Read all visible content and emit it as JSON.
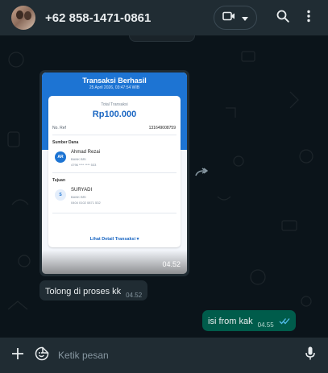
{
  "header": {
    "contact_name": "+62 858-1471-0861",
    "video_icon": "video-camera-icon",
    "dropdown_icon": "chevron-down-icon",
    "search_icon": "search-icon",
    "menu_icon": "kebab-menu-icon"
  },
  "receipt": {
    "title": "Transaksi Berhasil",
    "datetime": "25 April 2026, 03:47:54 WIB",
    "total_label": "Total Transaksi",
    "amount": "Rp100.000",
    "ref_label": "No. Ref",
    "ref_value": "131649008759",
    "source_section": "Sumber Dana",
    "source_initials": "AR",
    "source_name": "Ahmad Rezai",
    "source_bank": "BANK BRI",
    "source_account": "4796 **** **** 533",
    "dest_section": "Tujuan",
    "dest_initials": "S",
    "dest_name": "SURYADI",
    "dest_bank": "BANK BRI",
    "dest_account": "0404 0102 0871 532",
    "detail_link": "Lihat Detail Transaksi ▾",
    "time": "04.52"
  },
  "messages": [
    {
      "text": "Tolong di proses kk",
      "time": "04.52",
      "direction": "incoming"
    },
    {
      "text": "isi from kak",
      "time": "04.55",
      "direction": "outgoing",
      "status": "read"
    }
  ],
  "composer": {
    "placeholder": "Ketik pesan",
    "attach_icon": "plus-icon",
    "sticker_icon": "sticker-icon",
    "mic_icon": "microphone-icon"
  },
  "colors": {
    "header_bg": "#202c33",
    "chat_bg": "#0b141a",
    "incoming_bubble": "#202c33",
    "outgoing_bubble": "#005c4b",
    "receipt_blue": "#1d74d3",
    "read_tick": "#53bdeb"
  }
}
